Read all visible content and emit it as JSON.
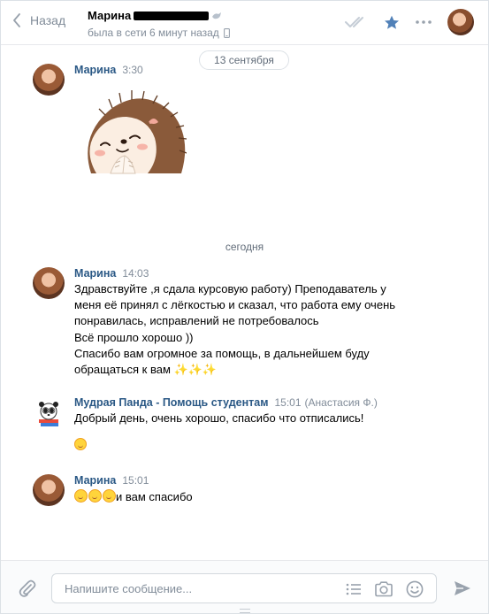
{
  "header": {
    "back_label": "Назад",
    "peer_name": "Марина",
    "peer_status": "была в сети 6 минут назад"
  },
  "date_pill": "13 сентября",
  "date_separator": "сегодня",
  "messages": [
    {
      "author": "Марина",
      "time": "3:30",
      "sticker": "hedgehog-sticker"
    },
    {
      "author": "Марина",
      "time": "14:03",
      "lines": [
        "Здравствуйте ,я сдала курсовую работу) Преподаватель у",
        "меня её принял с лёгкостью и сказал, что работа ему очень",
        "понравилась, исправлений не потребовалось",
        "Всё прошло хорошо ))",
        "Спасибо вам огромное за помощь, в дальнейшем буду",
        "обращаться к вам"
      ],
      "trailing": "✨✨✨"
    },
    {
      "author": "Мудрая Панда - Помощь студентам",
      "time": "15:01",
      "signature": "(Анастасия Ф.)",
      "text": "Добрый день, очень хорошо, спасибо что отписались!"
    },
    {
      "author": "Марина",
      "time": "15:01",
      "text": "и вам спасибо"
    }
  ],
  "composer": {
    "placeholder": "Напишите сообщение..."
  },
  "colors": {
    "author": "#2a5885",
    "muted": "#818c99",
    "accent": "#5181b8"
  }
}
